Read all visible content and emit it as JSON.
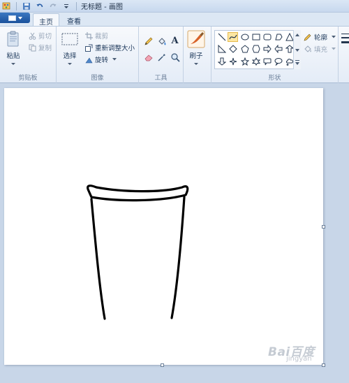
{
  "window": {
    "title": "无标题 - 画图"
  },
  "quick_access": {
    "icons": [
      "paint-app-icon",
      "save-icon",
      "undo-icon",
      "redo-icon",
      "customize-qat-icon"
    ]
  },
  "tabs": [
    {
      "label": "主页",
      "active": true
    },
    {
      "label": "查看",
      "active": false
    }
  ],
  "clipboard": {
    "paste_label": "粘贴",
    "cut_label": "剪切",
    "copy_label": "复制",
    "group_label": "剪贴板"
  },
  "image": {
    "select_label": "选择",
    "crop_label": "裁剪",
    "resize_label": "重新调整大小",
    "rotate_label": "旋转",
    "group_label": "图像"
  },
  "tools": {
    "items": [
      "pencil-icon",
      "fill-icon",
      "text-icon",
      "eraser-icon",
      "color-picker-icon",
      "magnifier-icon"
    ],
    "text_glyph": "A",
    "group_label": "工具"
  },
  "brushes": {
    "label": "刷子"
  },
  "shapes": {
    "outline_label": "轮廓",
    "fill_label": "填充",
    "group_label": "形状",
    "selected": "curve"
  },
  "colors": {
    "accent": "#1f5fad",
    "ribbon_bg": "#f3f6fb",
    "canvas_bg": "#c8d6e8",
    "paper": "#ffffff",
    "stroke": "#000000",
    "shape_selected": "#fde7a3"
  },
  "watermark": {
    "text": "Bai百度",
    "sub": "jingyan"
  }
}
